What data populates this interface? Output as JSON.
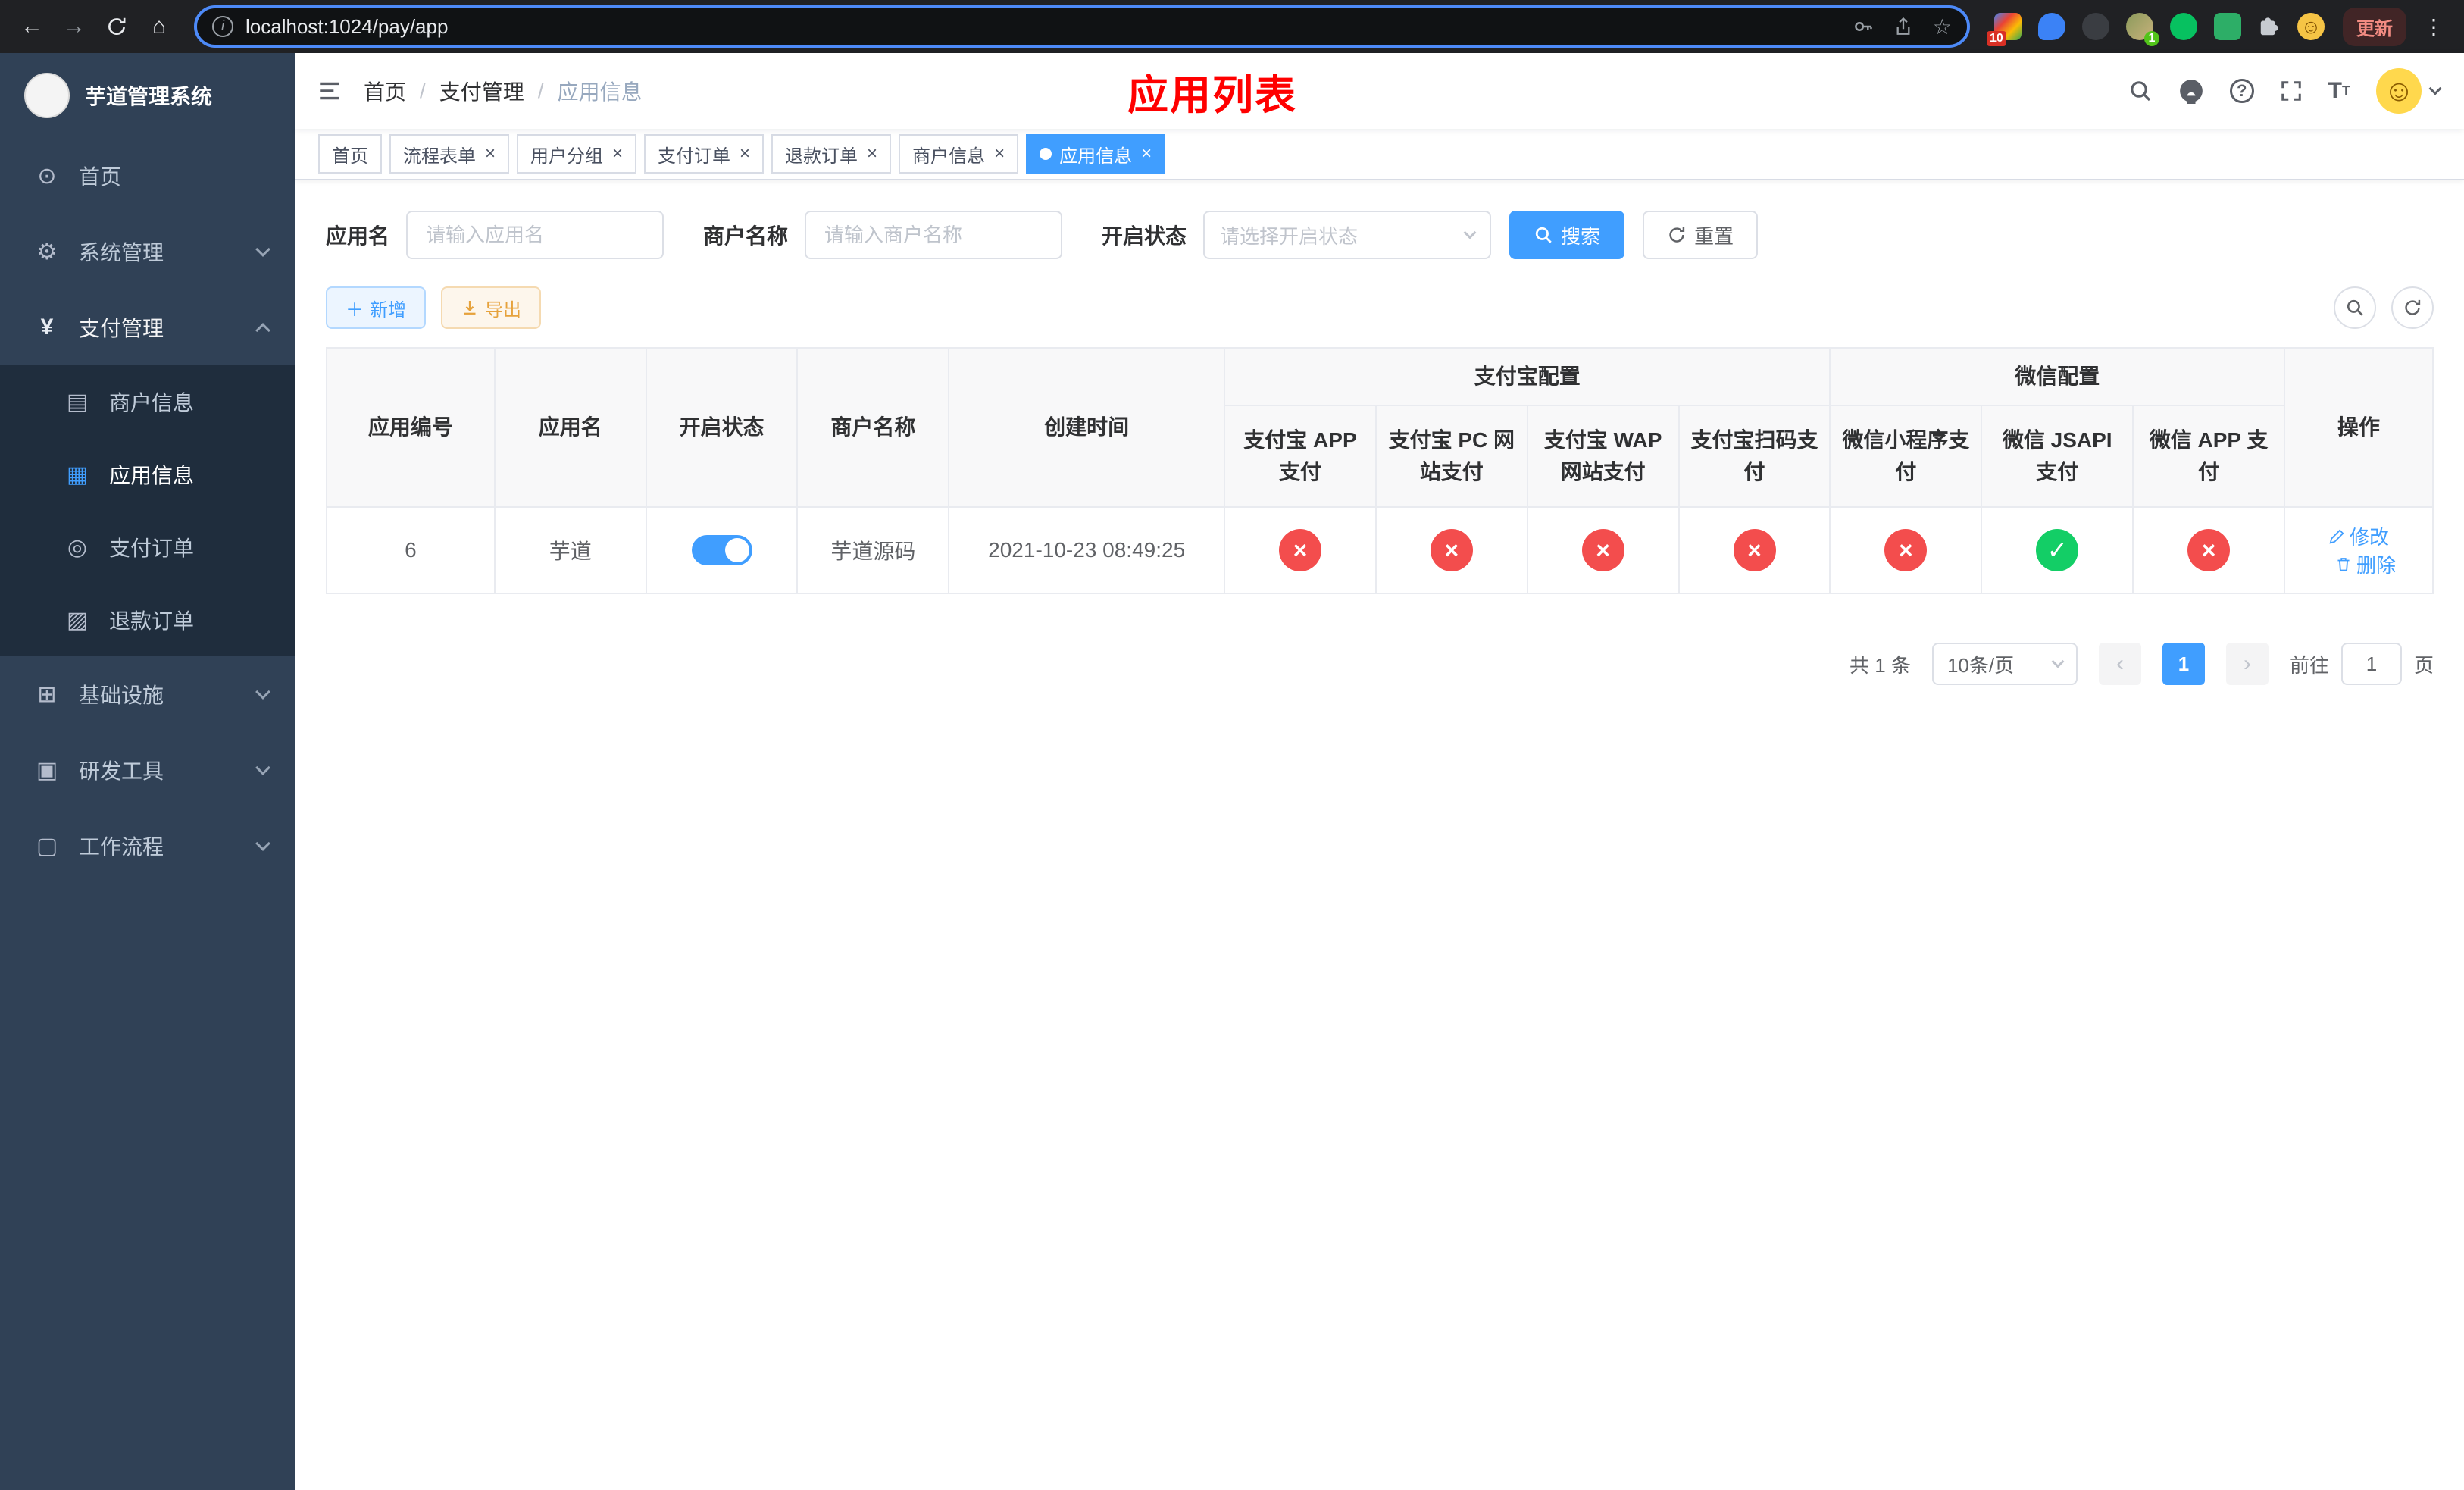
{
  "browser": {
    "url": "localhost:1024/pay/app",
    "update_label": "更新",
    "ext_badge": "10",
    "avatar_badge": "1"
  },
  "app": {
    "title": "芋道管理系统"
  },
  "sidebar": {
    "items": [
      {
        "label": "首页"
      },
      {
        "label": "系统管理"
      },
      {
        "label": "支付管理"
      },
      {
        "label": "商户信息"
      },
      {
        "label": "应用信息"
      },
      {
        "label": "支付订单"
      },
      {
        "label": "退款订单"
      },
      {
        "label": "基础设施"
      },
      {
        "label": "研发工具"
      },
      {
        "label": "工作流程"
      }
    ]
  },
  "breadcrumb": {
    "items": [
      "首页",
      "支付管理",
      "应用信息"
    ]
  },
  "header": {
    "page_title": "应用列表"
  },
  "tabs": {
    "items": [
      {
        "label": "首页"
      },
      {
        "label": "流程表单"
      },
      {
        "label": "用户分组"
      },
      {
        "label": "支付订单"
      },
      {
        "label": "退款订单"
      },
      {
        "label": "商户信息"
      },
      {
        "label": "应用信息"
      }
    ]
  },
  "filters": {
    "app_name_label": "应用名",
    "app_name_placeholder": "请输入应用名",
    "merchant_label": "商户名称",
    "merchant_placeholder": "请输入商户名称",
    "status_label": "开启状态",
    "status_placeholder": "请选择开启状态",
    "search_label": "搜索",
    "reset_label": "重置"
  },
  "toolbar": {
    "add_label": "新增",
    "export_label": "导出"
  },
  "table": {
    "groups": {
      "alipay": "支付宝配置",
      "wechat": "微信配置"
    },
    "columns": [
      "应用编号",
      "应用名",
      "开启状态",
      "商户名称",
      "创建时间",
      "支付宝 APP 支付",
      "支付宝 PC 网站支付",
      "支付宝 WAP 网站支付",
      "支付宝扫码支付",
      "微信小程序支付",
      "微信 JSAPI 支付",
      "微信 APP 支付",
      "操作"
    ],
    "rows": [
      {
        "id": "6",
        "name": "芋道",
        "enabled": true,
        "merchant": "芋道源码",
        "created": "2021-10-23 08:49:25",
        "statuses": [
          false,
          false,
          false,
          false,
          false,
          true,
          false
        ],
        "edit_label": "修改",
        "delete_label": "删除"
      }
    ]
  },
  "pagination": {
    "total": "共 1 条",
    "page_size": "10条/页",
    "current": "1",
    "goto_prefix": "前往",
    "goto_value": "1",
    "goto_suffix": "页"
  },
  "colors": {
    "primary": "#409eff",
    "success": "#13ce66",
    "danger": "#f34d4d",
    "page_title": "#ff0000",
    "sidebar_bg": "#304156",
    "submenu_bg": "#1f2d3d"
  }
}
